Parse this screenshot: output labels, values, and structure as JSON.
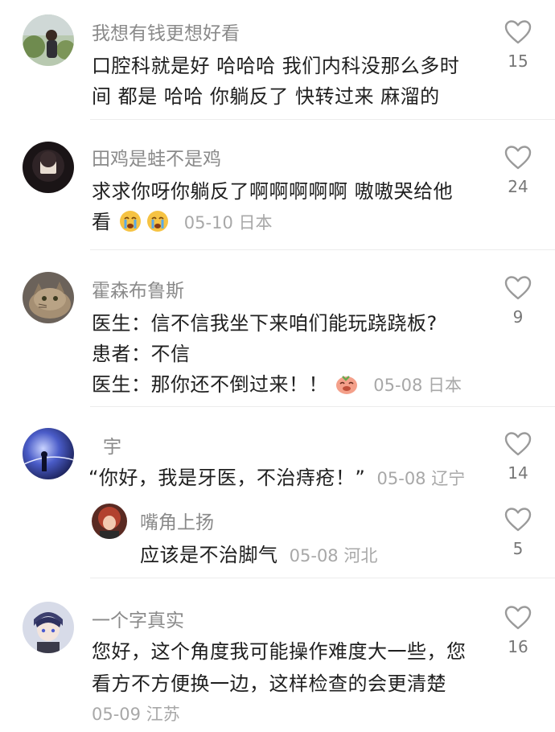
{
  "comments": [
    {
      "username": "我想有钱更想好看",
      "lines": [
        "口腔科就是好 哈哈哈 我们内科没那么多时",
        "间 都是 哈哈 你躺反了 快转过来 麻溜的"
      ],
      "meta": "",
      "likes": "15",
      "avatar_icon": "avatar-woman-outdoor"
    },
    {
      "username": "田鸡是蛙不是鸡",
      "lines": [
        "求求你呀你躺反了啊啊啊啊啊 嗷嗷哭给他",
        "看"
      ],
      "meta": "05-10 日本",
      "likes": "24",
      "avatar_icon": "avatar-girl-dark"
    },
    {
      "username": "霍森布鲁斯",
      "lines": [
        "医生：信不信我坐下来咱们能玩跷跷板?",
        "患者：不信",
        "医生：那你还不倒过来！！"
      ],
      "meta": "05-08 日本",
      "likes": "9",
      "avatar_icon": "avatar-cat"
    },
    {
      "username": "宇",
      "lines": [
        "“你好，我是牙医，不治痔疮！”"
      ],
      "meta": "05-08 辽宁",
      "likes": "14",
      "avatar_icon": "avatar-night-sky",
      "reply": {
        "username": "嘴角上扬",
        "lines": [
          "应该是不治脚气"
        ],
        "meta": "05-08 河北",
        "likes": "5",
        "avatar_icon": "avatar-red-hair"
      }
    },
    {
      "username": "一个字真实",
      "lines": [
        "您好，这个角度我可能操作难度大一些，您",
        "看方不方便换一边，这样检查的会更清楚"
      ],
      "meta": "05-09 江苏",
      "likes": "16",
      "avatar_icon": "avatar-anime-boy"
    }
  ],
  "colors": {
    "username": "#8a8a8a",
    "text": "#1f1f1f",
    "meta": "#a8a8a8",
    "heart_outline": "#9a9a9a"
  }
}
